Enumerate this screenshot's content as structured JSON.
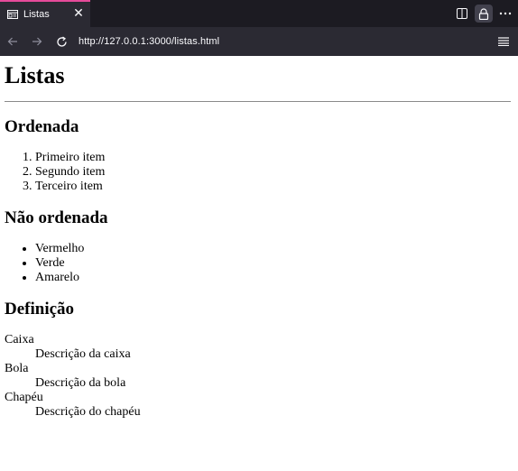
{
  "browser": {
    "tab_title": "Listas",
    "tab_close": "✕",
    "url": "http://127.0.0.1:3000/listas.html"
  },
  "page": {
    "title": "Listas",
    "ordered": {
      "heading": "Ordenada",
      "items": [
        "Primeiro item",
        "Segundo item",
        "Terceiro item"
      ]
    },
    "unordered": {
      "heading": "Não ordenada",
      "items": [
        "Vermelho",
        "Verde",
        "Amarelo"
      ]
    },
    "definitions": {
      "heading": "Definição",
      "entries": [
        {
          "term": "Caixa",
          "desc": "Descrição da caixa"
        },
        {
          "term": "Bola",
          "desc": "Descrição da bola"
        },
        {
          "term": "Chapéu",
          "desc": "Descrição do chapéu"
        }
      ]
    }
  }
}
